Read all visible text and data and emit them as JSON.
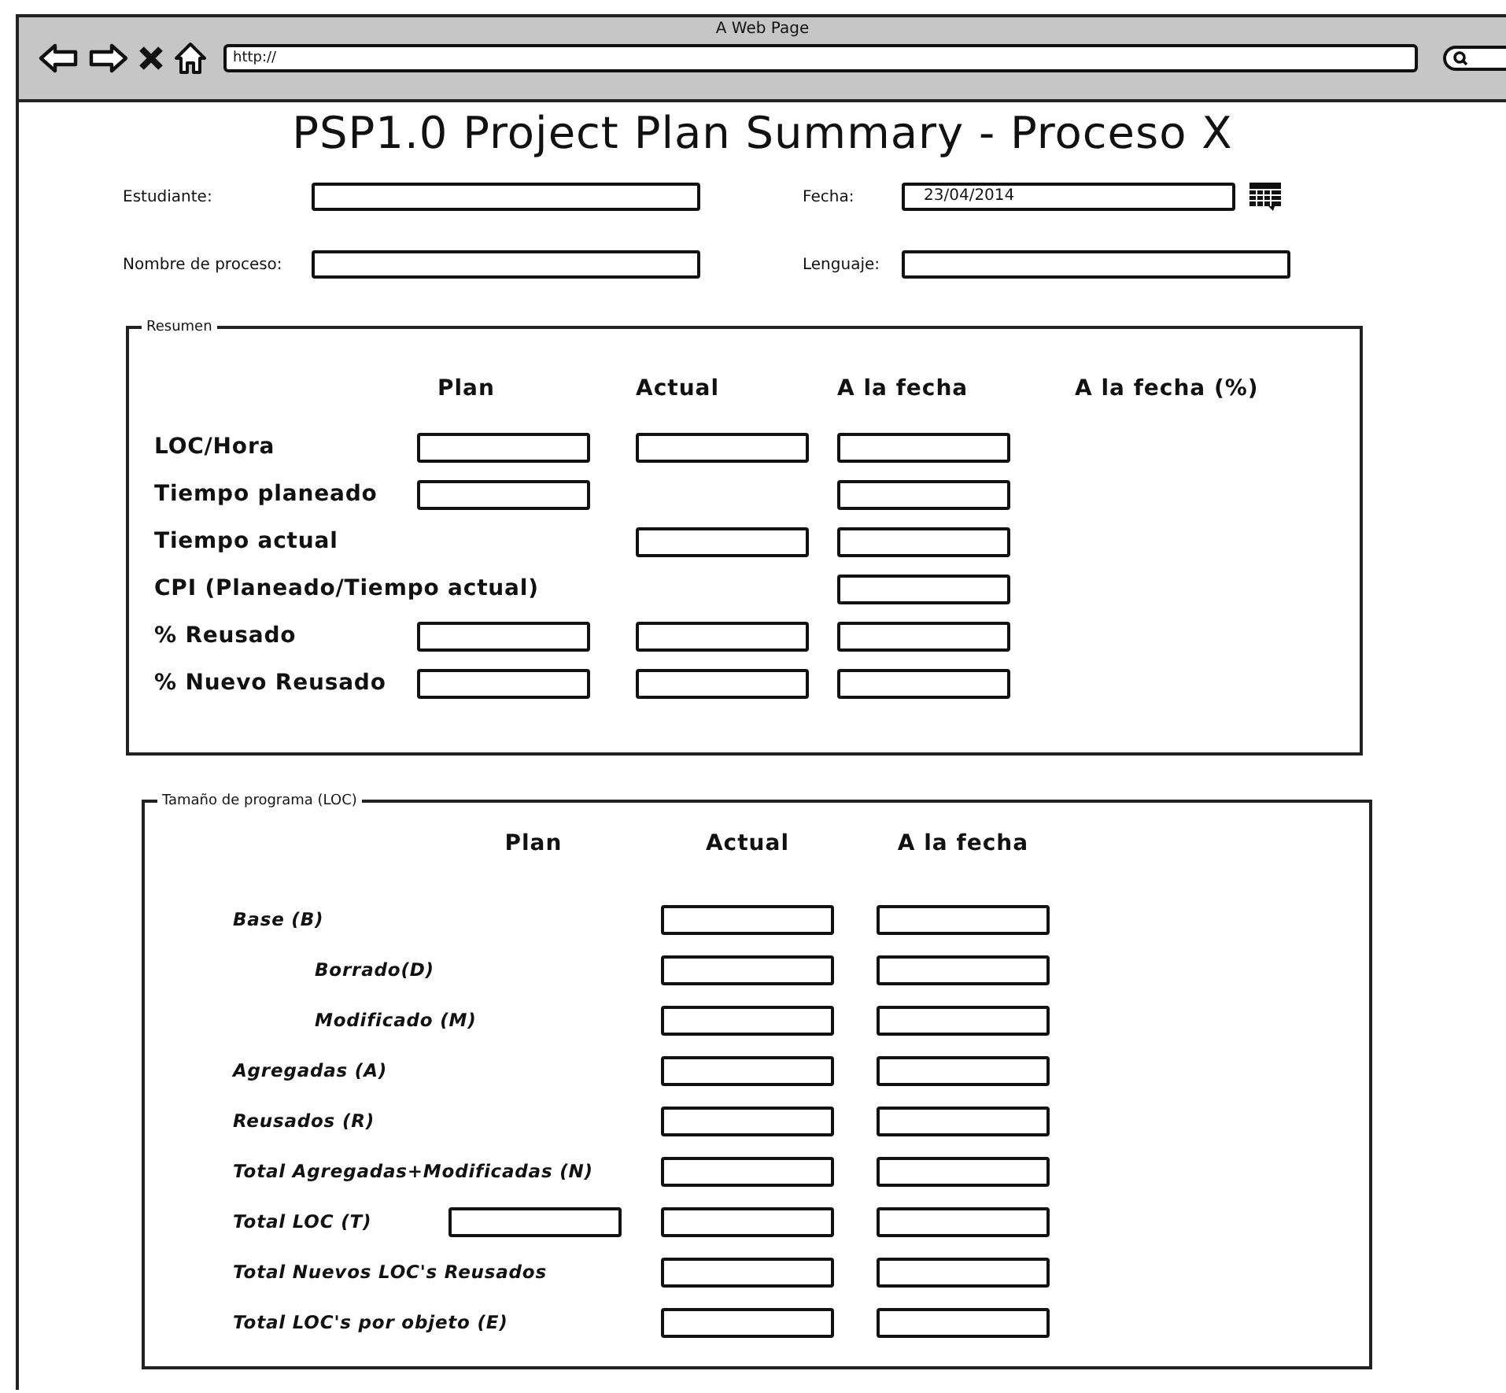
{
  "browser": {
    "title": "A Web Page",
    "url": "http://"
  },
  "title": "PSP1.0 Project Plan Summary - Proceso X",
  "fields": [
    {
      "label": "Estudiante:",
      "kind": "text"
    },
    {
      "label": "Fecha:",
      "value": "23/04/2014",
      "kind": "date"
    },
    {
      "label": "Nombre de proceso:",
      "kind": "text"
    },
    {
      "label": "Lenguaje:",
      "kind": "text"
    }
  ],
  "summary": {
    "legend": "Resumen",
    "columns": [
      "Plan",
      "Actual",
      "A la fecha",
      "A la fecha (%)"
    ],
    "rows": [
      {
        "label": "LOC/Hora",
        "plan": true,
        "actual": true,
        "to_date": true
      },
      {
        "label": "Tiempo planeado",
        "plan": true,
        "actual": false,
        "to_date": true
      },
      {
        "label": "Tiempo actual",
        "plan": false,
        "actual": true,
        "to_date": true
      },
      {
        "label": "CPI (Planeado/Tiempo actual)",
        "plan": false,
        "actual": false,
        "to_date": true
      },
      {
        "label": "% Reusado",
        "plan": true,
        "actual": true,
        "to_date": true
      },
      {
        "label": "% Nuevo Reusado",
        "plan": true,
        "actual": true,
        "to_date": true
      }
    ]
  },
  "size": {
    "legend": "Tamaño de programa (LOC)",
    "columns": [
      "Plan",
      "Actual",
      "A la fecha"
    ],
    "rows": [
      {
        "label": "Base (B)",
        "plan": false,
        "actual": true,
        "to_date": true,
        "children": [
          {
            "label": "Borrado(D)",
            "plan": false,
            "actual": true,
            "to_date": true
          },
          {
            "label": "Modificado (M)",
            "plan": false,
            "actual": true,
            "to_date": true
          }
        ]
      },
      {
        "label": "Agregadas (A)",
        "plan": false,
        "actual": true,
        "to_date": true
      },
      {
        "label": "Reusados (R)",
        "plan": false,
        "actual": true,
        "to_date": true
      },
      {
        "label": "Total Agregadas+Modificadas (N)",
        "plan": false,
        "actual": true,
        "to_date": true
      },
      {
        "label": "Total LOC (T)",
        "plan": true,
        "actual": true,
        "to_date": true
      },
      {
        "label": "Total Nuevos LOC's Reusados",
        "plan": false,
        "actual": true,
        "to_date": true
      },
      {
        "label": "Total LOC's por objeto (E)",
        "plan": false,
        "actual": true,
        "to_date": true
      }
    ]
  }
}
